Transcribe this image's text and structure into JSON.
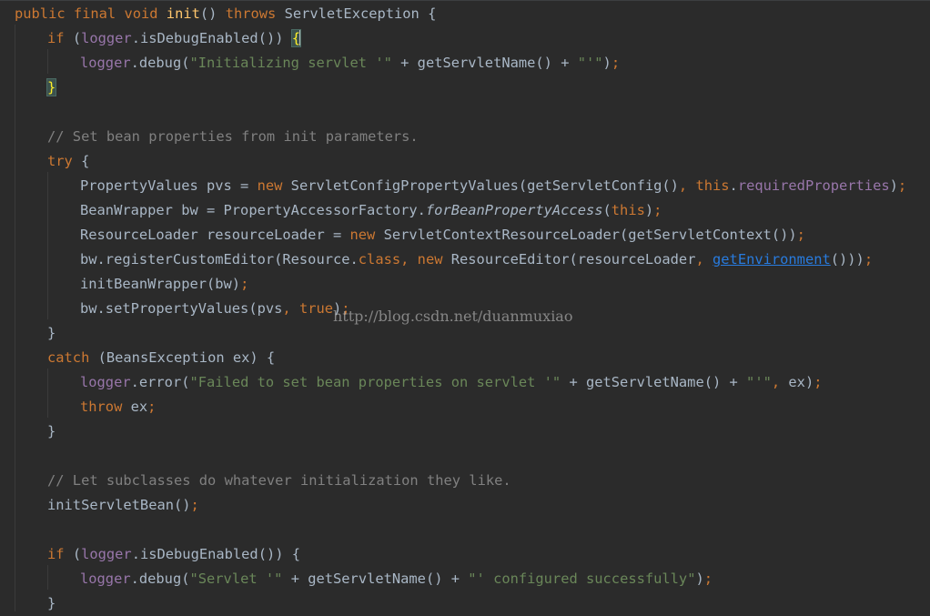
{
  "editor": {
    "watermark": "http://blog.csdn.net/duanmuxiao",
    "lines": [
      {
        "indent": 0,
        "tokens": [
          {
            "t": "public final void ",
            "c": "kw"
          },
          {
            "t": "init",
            "c": "fn"
          },
          {
            "t": "() ",
            "c": ""
          },
          {
            "t": "throws ",
            "c": "kw"
          },
          {
            "t": "ServletException {",
            "c": ""
          }
        ]
      },
      {
        "indent": 1,
        "tokens": [
          {
            "t": "if ",
            "c": "kw"
          },
          {
            "t": "(",
            "c": ""
          },
          {
            "t": "logger",
            "c": "fld"
          },
          {
            "t": ".isDebugEnabled()) ",
            "c": ""
          },
          {
            "t": "{",
            "c": "bracematch"
          },
          {
            "t": "",
            "c": "caret"
          }
        ]
      },
      {
        "indent": 2,
        "tokens": [
          {
            "t": "logger",
            "c": "fld"
          },
          {
            "t": ".debug(",
            "c": ""
          },
          {
            "t": "\"Initializing servlet '\"",
            "c": "str"
          },
          {
            "t": " + getServletName() + ",
            "c": ""
          },
          {
            "t": "\"'\"",
            "c": "str"
          },
          {
            "t": ")",
            "c": ""
          },
          {
            "t": ";",
            "c": "semi"
          }
        ]
      },
      {
        "indent": 1,
        "tokens": [
          {
            "t": "}",
            "c": "bracematch"
          }
        ]
      },
      {
        "indent": 0,
        "tokens": []
      },
      {
        "indent": 1,
        "tokens": [
          {
            "t": "// Set bean properties from init parameters.",
            "c": "cm"
          }
        ]
      },
      {
        "indent": 1,
        "tokens": [
          {
            "t": "try ",
            "c": "kw"
          },
          {
            "t": "{",
            "c": ""
          }
        ]
      },
      {
        "indent": 2,
        "tokens": [
          {
            "t": "PropertyValues pvs = ",
            "c": ""
          },
          {
            "t": "new ",
            "c": "kw"
          },
          {
            "t": "ServletConfigPropertyValues(getServletConfig()",
            "c": ""
          },
          {
            "t": ", ",
            "c": "semi"
          },
          {
            "t": "this",
            "c": "kw"
          },
          {
            "t": ".",
            "c": ""
          },
          {
            "t": "requiredProperties",
            "c": "fld"
          },
          {
            "t": ")",
            "c": ""
          },
          {
            "t": ";",
            "c": "semi"
          }
        ]
      },
      {
        "indent": 2,
        "tokens": [
          {
            "t": "BeanWrapper bw = PropertyAccessorFactory.",
            "c": ""
          },
          {
            "t": "forBeanPropertyAccess",
            "c": "static"
          },
          {
            "t": "(",
            "c": ""
          },
          {
            "t": "this",
            "c": "kw"
          },
          {
            "t": ")",
            "c": ""
          },
          {
            "t": ";",
            "c": "semi"
          }
        ]
      },
      {
        "indent": 2,
        "tokens": [
          {
            "t": "ResourceLoader resourceLoader = ",
            "c": ""
          },
          {
            "t": "new ",
            "c": "kw"
          },
          {
            "t": "ServletContextResourceLoader(getServletContext())",
            "c": ""
          },
          {
            "t": ";",
            "c": "semi"
          }
        ]
      },
      {
        "indent": 2,
        "tokens": [
          {
            "t": "bw.registerCustomEditor(Resource.",
            "c": ""
          },
          {
            "t": "class",
            "c": "kw"
          },
          {
            "t": ", ",
            "c": "semi"
          },
          {
            "t": "new ",
            "c": "kw"
          },
          {
            "t": "ResourceEditor(resourceLoader",
            "c": ""
          },
          {
            "t": ", ",
            "c": "semi"
          },
          {
            "t": "getEnvironment",
            "c": "link"
          },
          {
            "t": "()))",
            "c": ""
          },
          {
            "t": ";",
            "c": "semi"
          }
        ]
      },
      {
        "indent": 2,
        "tokens": [
          {
            "t": "initBeanWrapper(bw)",
            "c": ""
          },
          {
            "t": ";",
            "c": "semi"
          }
        ]
      },
      {
        "indent": 2,
        "tokens": [
          {
            "t": "bw.setPropertyValues(pvs",
            "c": ""
          },
          {
            "t": ", ",
            "c": "semi"
          },
          {
            "t": "true",
            "c": "kw"
          },
          {
            "t": ")",
            "c": ""
          },
          {
            "t": ";",
            "c": "semi"
          }
        ]
      },
      {
        "indent": 1,
        "tokens": [
          {
            "t": "}",
            "c": ""
          }
        ]
      },
      {
        "indent": 1,
        "tokens": [
          {
            "t": "catch ",
            "c": "kw"
          },
          {
            "t": "(BeansException ex) {",
            "c": ""
          }
        ]
      },
      {
        "indent": 2,
        "tokens": [
          {
            "t": "logger",
            "c": "fld"
          },
          {
            "t": ".error(",
            "c": ""
          },
          {
            "t": "\"Failed to set bean properties on servlet '\"",
            "c": "str"
          },
          {
            "t": " + getServletName() + ",
            "c": ""
          },
          {
            "t": "\"'\"",
            "c": "str"
          },
          {
            "t": ", ",
            "c": "semi"
          },
          {
            "t": "ex)",
            "c": ""
          },
          {
            "t": ";",
            "c": "semi"
          }
        ]
      },
      {
        "indent": 2,
        "tokens": [
          {
            "t": "throw ",
            "c": "kw"
          },
          {
            "t": "ex",
            "c": ""
          },
          {
            "t": ";",
            "c": "semi"
          }
        ]
      },
      {
        "indent": 1,
        "tokens": [
          {
            "t": "}",
            "c": ""
          }
        ]
      },
      {
        "indent": 0,
        "tokens": []
      },
      {
        "indent": 1,
        "tokens": [
          {
            "t": "// Let subclasses do whatever initialization they like.",
            "c": "cm"
          }
        ]
      },
      {
        "indent": 1,
        "tokens": [
          {
            "t": "initServletBean()",
            "c": ""
          },
          {
            "t": ";",
            "c": "semi"
          }
        ]
      },
      {
        "indent": 0,
        "tokens": []
      },
      {
        "indent": 1,
        "tokens": [
          {
            "t": "if ",
            "c": "kw"
          },
          {
            "t": "(",
            "c": ""
          },
          {
            "t": "logger",
            "c": "fld"
          },
          {
            "t": ".isDebugEnabled()) {",
            "c": ""
          }
        ]
      },
      {
        "indent": 2,
        "tokens": [
          {
            "t": "logger",
            "c": "fld"
          },
          {
            "t": ".debug(",
            "c": ""
          },
          {
            "t": "\"Servlet '\"",
            "c": "str"
          },
          {
            "t": " + getServletName() + ",
            "c": ""
          },
          {
            "t": "\"' configured successfully\"",
            "c": "str"
          },
          {
            "t": ")",
            "c": ""
          },
          {
            "t": ";",
            "c": "semi"
          }
        ]
      },
      {
        "indent": 1,
        "tokens": [
          {
            "t": "}",
            "c": ""
          }
        ]
      }
    ]
  }
}
